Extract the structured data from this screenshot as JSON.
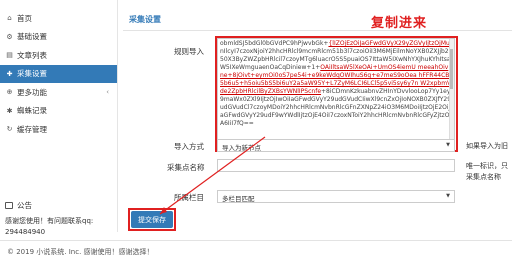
{
  "sidebar": {
    "items": [
      {
        "label": "首页",
        "icon": "home-icon",
        "glyph": "⌂"
      },
      {
        "label": "基础设置",
        "icon": "gear-icon",
        "glyph": "⚙"
      },
      {
        "label": "文章列表",
        "icon": "file-icon",
        "glyph": "▤"
      },
      {
        "label": "采集设置",
        "icon": "collect-icon",
        "glyph": "✚",
        "active": true
      },
      {
        "label": "更多功能",
        "icon": "more-icon",
        "glyph": "⊕",
        "has_chevron": true
      },
      {
        "label": "蜘蛛记录",
        "icon": "spider-icon",
        "glyph": "✱"
      },
      {
        "label": "缓存管理",
        "icon": "refresh-icon",
        "glyph": "↻"
      }
    ],
    "notice": {
      "title": "公告",
      "line1": "感谢您使用！有问题联系qq:",
      "line2": "294484940"
    }
  },
  "main": {
    "title": "采集设置",
    "annotation": "复制进来",
    "fields": {
      "import_label": "规则导入",
      "import_value_normal_1": "obmldSJ5bdGl0bGVdPC9hPjwvbGk+",
      "import_value_red_1": "{lIZOjEzOiJaGFwdGVyX29yZGVyIjtzOjMu",
      "import_value_normal_2": "nIlcyI7czoxNjoiY2hhcHRlcl9mcmRlcm51b3l7czoiOiI3M6MjEilmNoYXB0ZXJjb250X3ByZWZpbHRlcil7czoyMTg6luacrO5S5puaiOS7IttaW5IXwNhYXJhuKYhItsaW5IXeWmguaenOaCqDiniew+1+",
      "import_value_red_2": "OAiIltsaW5lXeOAi+UmOS4iemU\nmeeahOivne+8jOivt+eymOi0oS7pe54i+e9keWdqOWIhuS6g+e7meS9oOea\nhFFR44CB5b6u5+h5oiu5bS5bi6uY2a5aW95Y+L7ZyM6LCI6LCl5p5vi5sy6y7n\nW2xpbmVde2ZpbHRlcilByZXBsYWNlIPScnfe",
      "import_value_normal_3": "+8iCDmnKzkuabnvZHInYDvvlooLop7Yy1ey9maWx0ZXl9IjtzOjIwOiIaGFwdGVyY29udGVudCIiwXl9cnZxOjIoNOXB0ZXJfY29udGVudCl7czoyMDoiY2hhcHRlcmNvbnRlcGFnZXNpZ24iO3M6MDoiIjtzOjE2OiJaGFwdGVyY29udF9wYWdlIjtzOjE4OiI7czoxNToiY2hhcHRlcmNvbnRlcGFyZjtzOjA6IiI7fQ==",
      "mode_label": "导入方式",
      "mode_value": "导入为新节点",
      "mode_help": "如果导入为旧",
      "name_label": "采集点名称",
      "name_value": "",
      "name_help_1": "唯一标识，只",
      "name_help_2": "采集点名称",
      "column_label": "所属栏目",
      "column_value": "多栏目匹配"
    },
    "submit_label": "提交保存"
  },
  "footer": {
    "text": "© 2019 小说系统. Inc. 感谢使用！感谢选择！"
  },
  "colors": {
    "accent": "#337ab7",
    "annotation_red": "#e02020"
  }
}
